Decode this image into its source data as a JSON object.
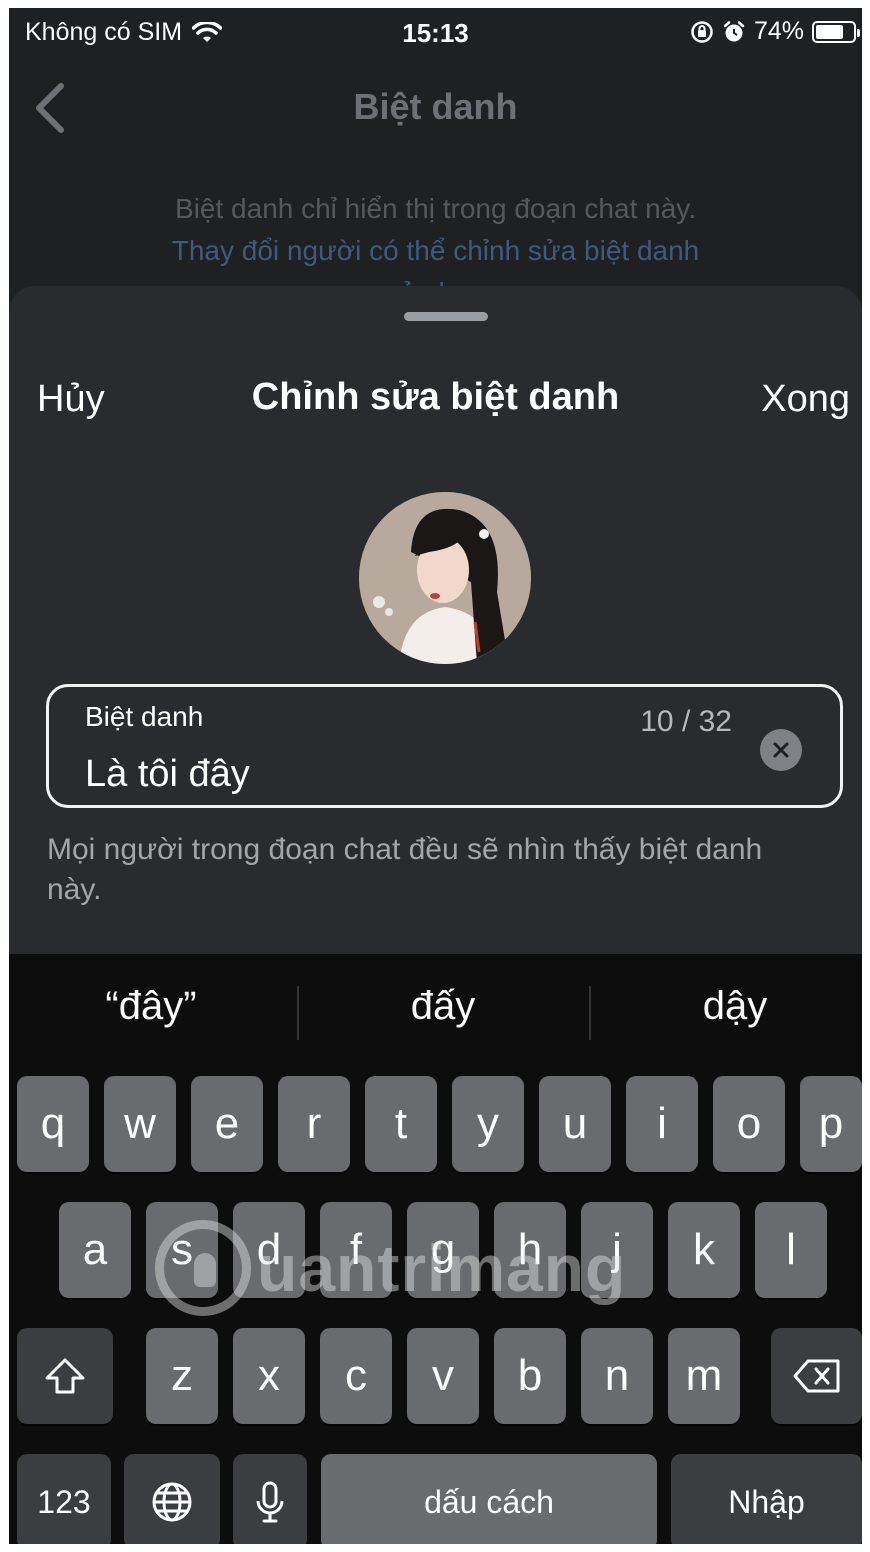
{
  "status_bar": {
    "carrier": "Không có SIM",
    "time": "15:13",
    "battery_percent": "74%",
    "battery_level": 0.74,
    "icons": [
      "wifi-icon",
      "rotation-lock-icon",
      "alarm-icon",
      "battery-icon"
    ]
  },
  "background_page": {
    "title": "Biệt danh",
    "description": "Biệt danh chỉ hiển thị trong đoạn chat này.",
    "link_text": "Thay đổi người có thể chỉnh sửa biệt danh",
    "link_text_cut": "của bạn"
  },
  "sheet": {
    "cancel_label": "Hủy",
    "title": "Chỉnh sửa biệt danh",
    "done_label": "Xong",
    "field": {
      "label": "Biệt danh",
      "counter": "10 / 32",
      "value": "Là tôi đây"
    },
    "helper_text": "Mọi người trong đoạn chat đều sẽ nhìn thấy biệt danh này."
  },
  "keyboard": {
    "suggestions": [
      "“đây”",
      "đấy",
      "dậy"
    ],
    "row1": [
      "q",
      "w",
      "e",
      "r",
      "t",
      "y",
      "u",
      "i",
      "o",
      "p"
    ],
    "row2": [
      "a",
      "s",
      "d",
      "f",
      "g",
      "h",
      "j",
      "k",
      "l"
    ],
    "row3": [
      "z",
      "x",
      "c",
      "v",
      "b",
      "n",
      "m"
    ],
    "numbers_label": "123",
    "space_label": "dấu cách",
    "return_label": "Nhập"
  },
  "watermark": {
    "text": "uantrimang"
  },
  "colors": {
    "sheet_bg": "#292b2f",
    "keyboard_bg": "#0d0d0d",
    "key_bg": "#6a6b6e",
    "key_dark_bg": "#3c3d40"
  }
}
